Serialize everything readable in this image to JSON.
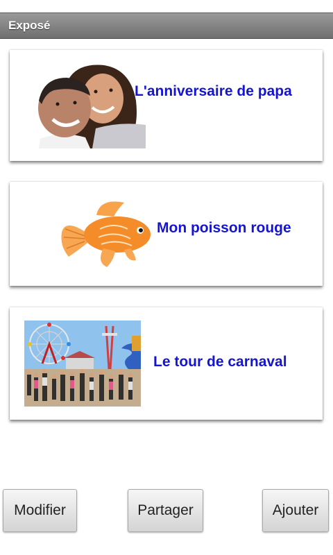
{
  "app": {
    "title": "Exposé"
  },
  "stories": [
    {
      "label": "L'anniversaire de papa",
      "image": "father-daughter-photo"
    },
    {
      "label": "Mon poisson rouge",
      "image": "goldfish-illustration"
    },
    {
      "label": "Le tour de carnaval",
      "image": "carnival-photo"
    }
  ],
  "buttons": {
    "edit": "Modifier",
    "share": "Partager",
    "add": "Ajouter"
  },
  "colors": {
    "label": "#1414d2",
    "titlebar": "#7f7f7f"
  }
}
